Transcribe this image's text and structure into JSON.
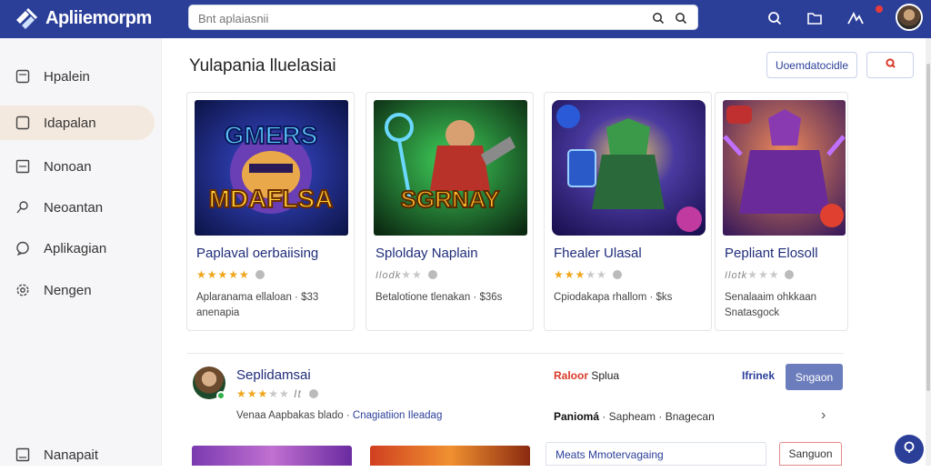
{
  "header": {
    "app_title": "Apliiemorpm",
    "search_placeholder": "Bnt aplaiasnii",
    "icons": [
      "search-icon",
      "folder-icon",
      "notification-icon",
      "avatar"
    ]
  },
  "sidebar": {
    "items": [
      {
        "label": "Hpalein",
        "icon": "square-icon"
      },
      {
        "label": "Idapalan",
        "icon": "square-icon",
        "active": true
      },
      {
        "label": "Nonoan",
        "icon": "square-icon"
      },
      {
        "label": "Neoantan",
        "icon": "search-icon"
      },
      {
        "label": "Aplikagian",
        "icon": "chat-icon"
      },
      {
        "label": "Nengen",
        "icon": "gear-icon"
      },
      {
        "label": "Nanapait",
        "icon": "square-icon"
      }
    ]
  },
  "main": {
    "section_title": "Yulapania lluelasiai",
    "header_button": "Uoemdatocidle",
    "cards": [
      {
        "art_text": "GMERS MDAFLSA",
        "title": "Paplaval oerbaiising",
        "rating": 5,
        "meta_line1": "Aplaranama ellaloan · $33",
        "meta_line2": "anenapia"
      },
      {
        "art_text": "SGRNAY",
        "title": "Splolday Naplain",
        "rating": 2,
        "rating_prefix": "Ilodk",
        "meta_line1": "Betalotione tlenakan · $36s",
        "meta_line2": ""
      },
      {
        "art_text": "",
        "title": "Fhealer Ulasal",
        "rating": 3,
        "meta_line1": "Cpiodakapa rhallom · $ks",
        "meta_line2": ""
      },
      {
        "art_text": "",
        "title": "Pepliant Elosoll",
        "rating": 0,
        "rating_prefix": "Ilotk",
        "meta_line1": "Senalaaim ohkkaan",
        "meta_line2": "Snatasgock"
      }
    ]
  },
  "review": {
    "name": "Seplidamsai",
    "stars_suffix": "It",
    "description": "Venaa Aapbakas blado · ",
    "description_link": "Cnagiatiion Ileadag",
    "tag_red": "Raloor",
    "tag_rest": "Splua",
    "link": "Ifrinek",
    "button": "Sngaon",
    "line2_bold": "Paniomá",
    "line2_rest": " · Sapheam · Bnagecan"
  },
  "bottom": {
    "promo_text": "Meats  Mmotervagaing",
    "promo_button": "Sanguon"
  },
  "colors": {
    "topbar": "#2b3f99",
    "accent": "#2b3f99",
    "active_nav": "#f4e9de",
    "star": "#f0a51a"
  }
}
